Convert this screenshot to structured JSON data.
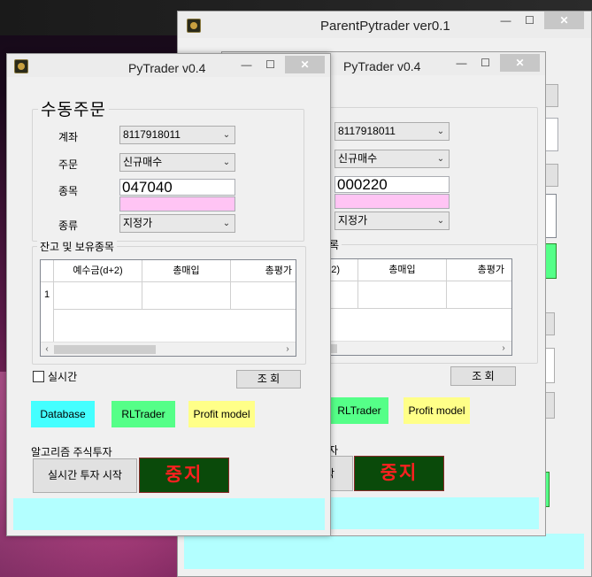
{
  "parent_window": {
    "title": "ParentPytrader ver0.1",
    "controls": {
      "minimize": "—",
      "maximize": "☐",
      "close": "✕"
    }
  },
  "back_window": {
    "title": "PyTrader v0.4",
    "controls": {
      "minimize": "—",
      "maximize": "☐",
      "close": "✕"
    },
    "account_value": "8117918011",
    "order_type_value": "신규매수",
    "code_value": "000220",
    "price_type_value": "지정가",
    "balance_group_title_partial": "록",
    "grid_headers": [
      "-2)",
      "총매입",
      "총평가"
    ],
    "inquiry_button": "조 회",
    "rltrader_button": "RLTrader",
    "profit_model_button": "Profit model",
    "algo_title_partial": "자",
    "start_button_partial": "작",
    "stop_button": "중지"
  },
  "front_window": {
    "title": "PyTrader v0.4",
    "controls": {
      "minimize": "—",
      "maximize": "☐",
      "close": "✕"
    },
    "manual_order_title": "수동주문",
    "account_label": "계좌",
    "account_value": "8117918011",
    "order_label": "주문",
    "order_type_value": "신규매수",
    "code_label": "종목",
    "code_value": "047040",
    "price_type_label": "종류",
    "price_type_value": "지정가",
    "balance_group_title": "잔고 및 보유종목",
    "grid_headers": [
      "예수금(d+2)",
      "총매입",
      "총평가"
    ],
    "grid_row_label": "1",
    "realtime_label": "실시간",
    "inquiry_button": "조 회",
    "database_button": "Database",
    "rltrader_button": "RLTrader",
    "profit_model_button": "Profit model",
    "algo_title": "알고리즘 주식투자",
    "start_button": "실시간 투자 시작",
    "stop_button": "중지"
  },
  "colors": {
    "database_button": "#44ffff",
    "rltrader_button": "#55ff88",
    "profit_model_button": "#ffff88",
    "stop_button_bg": "#0a4a0a",
    "stop_button_text": "#ff2020",
    "status_bar": "#b3ffff",
    "pink_box": "#ffc4f4"
  },
  "arrows": {
    "combo": "⌄",
    "left": "‹",
    "right": "›"
  }
}
